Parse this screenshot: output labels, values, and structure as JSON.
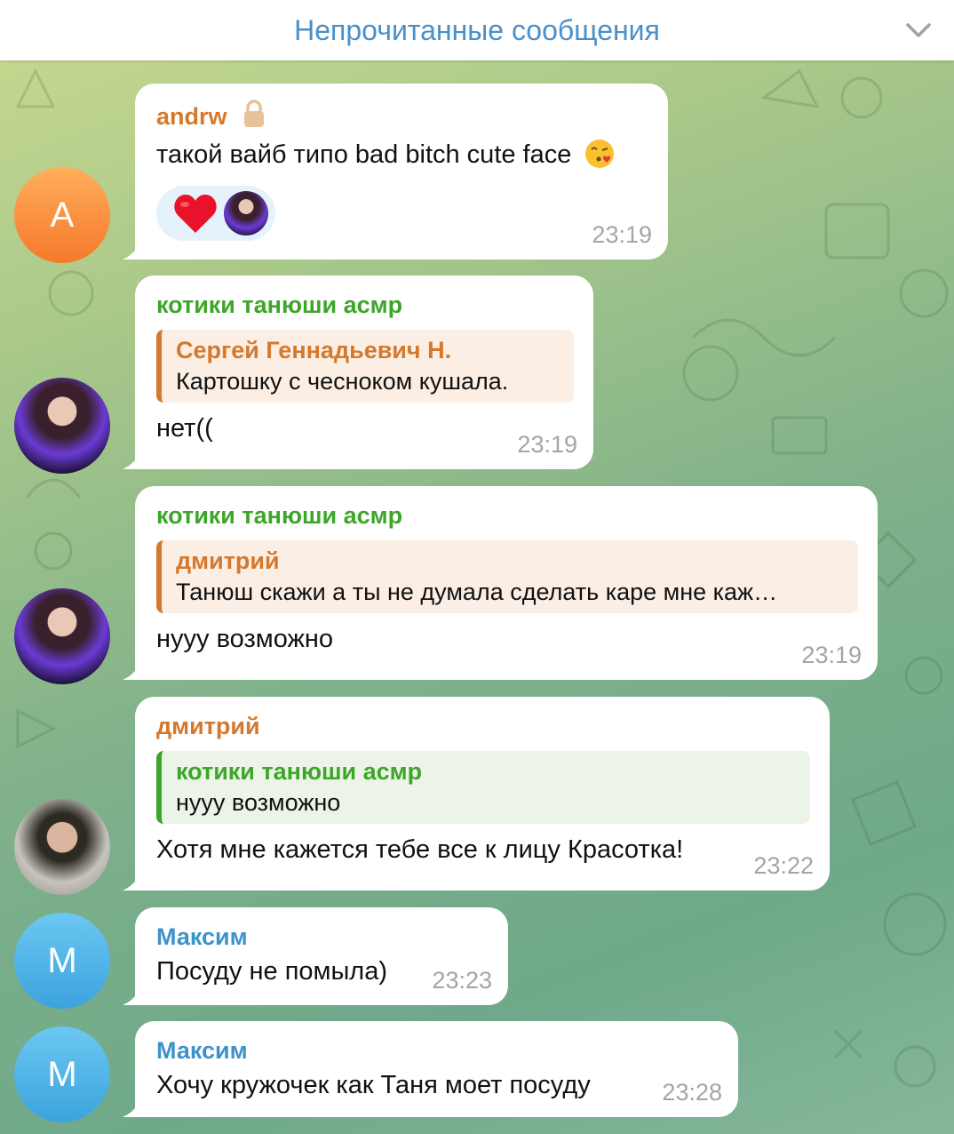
{
  "header": {
    "title": "Непрочитанные сообщения"
  },
  "messages": [
    {
      "avatar_letter": "A",
      "sender": "andrw",
      "text": "такой вайб типо bad bitch cute face",
      "time": "23:19",
      "reaction": "heart"
    },
    {
      "sender": "котики танюши асмр",
      "reply_name": "Сергей Геннадьевич Н.",
      "reply_text": "Картошку с чесноком кушала.",
      "text": "нет((",
      "time": "23:19"
    },
    {
      "sender": "котики танюши асмр",
      "reply_name": "дмитрий",
      "reply_text": "Танюш скажи а ты не думала сделать каре мне каж…",
      "text": "нууу возможно",
      "time": "23:19"
    },
    {
      "sender": "дмитрий",
      "reply_name": "котики танюши асмр",
      "reply_text": "нууу возможно",
      "text": "Хотя мне кажется тебе все к лицу Красотка!",
      "time": "23:22"
    },
    {
      "avatar_letter": "M",
      "sender": "Максим",
      "text": "Посуду не помыла)",
      "time": "23:23"
    },
    {
      "avatar_letter": "M",
      "sender": "Максим",
      "text": "Хочу кружочек как Таня моет посуду",
      "time": "23:28"
    }
  ],
  "colors": {
    "orange_name": "#d5782c",
    "green_name": "#3da62a",
    "blue_name": "#3d93c7",
    "header_title": "#4a8fc9"
  }
}
